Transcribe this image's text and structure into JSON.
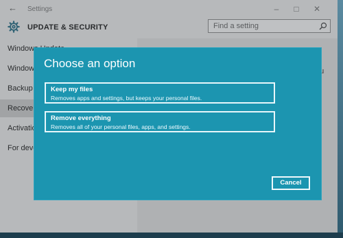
{
  "window": {
    "title": "Settings",
    "back_icon": "back-arrow-icon",
    "controls": [
      "minimize-icon",
      "maximize-icon",
      "close-icon"
    ]
  },
  "header": {
    "section_title": "UPDATE & SECURITY",
    "icon": "gear-icon",
    "search": {
      "placeholder": "Find a setting",
      "icon": "search-icon"
    }
  },
  "sidebar": {
    "items": [
      {
        "label": "Windows Update",
        "active": false
      },
      {
        "label": "Windows Defender",
        "active": false
      },
      {
        "label": "Backup",
        "active": false
      },
      {
        "label": "Recovery",
        "active": true
      },
      {
        "label": "Activation",
        "active": false
      },
      {
        "label": "For developers",
        "active": false
      }
    ]
  },
  "content": {
    "fragment": "ou"
  },
  "dialog": {
    "title": "Choose an option",
    "options": [
      {
        "title": "Keep my files",
        "description": "Removes apps and settings, but keeps your personal files."
      },
      {
        "title": "Remove everything",
        "description": "Removes all of your personal files, apps, and settings."
      }
    ],
    "cancel_label": "Cancel"
  },
  "colors": {
    "dialog_bg": "#1c95b0",
    "window_bg": "#e6e6e6",
    "sidebar_active": "#c8c8c8"
  }
}
